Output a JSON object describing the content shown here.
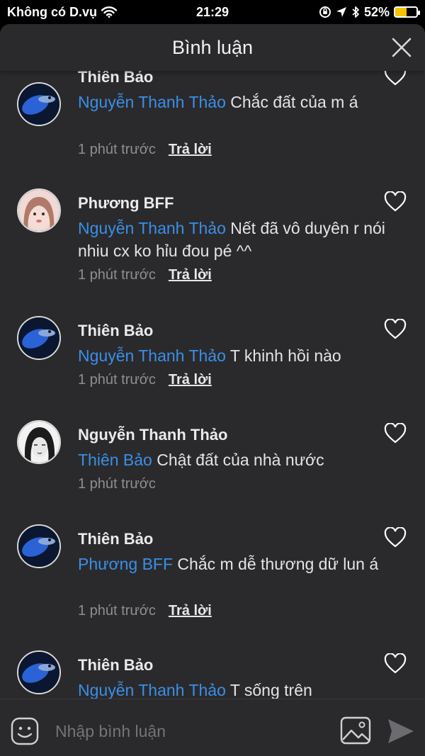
{
  "status_bar": {
    "carrier": "Không có D.vụ",
    "time": "21:29",
    "battery_percent": "52%",
    "battery_level": 0.52
  },
  "header": {
    "title": "Bình luận"
  },
  "comments": [
    {
      "author": "Thiên Bảo",
      "mention": "Nguyễn Thanh Thảo",
      "text": " Chắc đất của m á",
      "time": "1 phút trước",
      "reply": "Trả lời"
    },
    {
      "author": "Phương BFF",
      "mention": "Nguyễn Thanh Thảo",
      "text": " Nết đã vô duyên r nói nhiu cx ko hỉu đou pé ^^",
      "time": "1 phút trước",
      "reply": "Trả lời"
    },
    {
      "author": "Thiên Bảo",
      "mention": "Nguyễn Thanh Thảo",
      "text": " T khinh hồi nào",
      "time": "1 phút trước",
      "reply": "Trả lời"
    },
    {
      "author": "Nguyễn Thanh Thảo",
      "mention": "Thiên Bảo",
      "text": " Chật đất của nhà nước",
      "time": "1 phút trước"
    },
    {
      "author": "Thiên Bảo",
      "mention": "Phương BFF",
      "text": " Chắc m dễ thương dữ lun á",
      "time": "1 phút trước",
      "reply": "Trả lời"
    },
    {
      "author": "Thiên Bảo",
      "mention": "Nguyễn Thanh Thảo",
      "text": " T sống trên"
    }
  ],
  "input": {
    "placeholder": "Nhập bình luận"
  },
  "colors": {
    "accent": "#3a8fe8",
    "background": "#2a2a2c",
    "battery": "#f5c400"
  }
}
